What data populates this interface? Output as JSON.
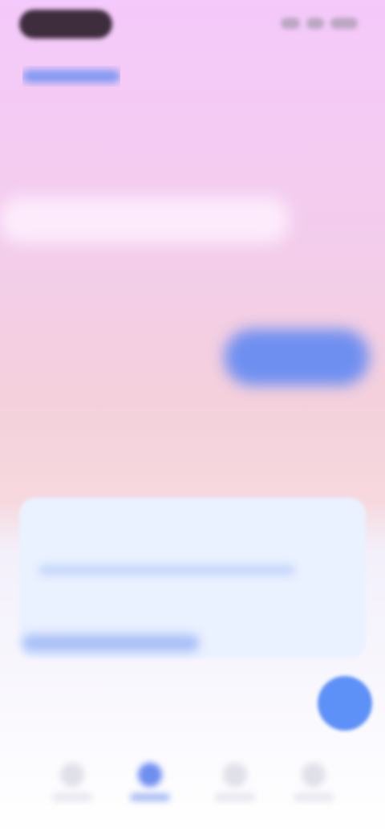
{
  "status_bar": {
    "time": ""
  },
  "header": {
    "back_label": ""
  },
  "hero": {
    "headline": "",
    "brand": ""
  },
  "card": {
    "text": "",
    "link_label": ""
  },
  "fab": {
    "icon": "plus-icon"
  },
  "bottom_nav": {
    "items": [
      {
        "label": "",
        "icon": "home-icon",
        "active": false
      },
      {
        "label": "",
        "icon": "circle-icon",
        "active": true
      },
      {
        "label": "",
        "icon": "grid-icon",
        "active": false
      },
      {
        "label": "",
        "icon": "person-icon",
        "active": false
      }
    ]
  },
  "colors": {
    "accent": "#6f8ff0",
    "fab": "#5e91f7",
    "card": "#eaf1ff"
  }
}
